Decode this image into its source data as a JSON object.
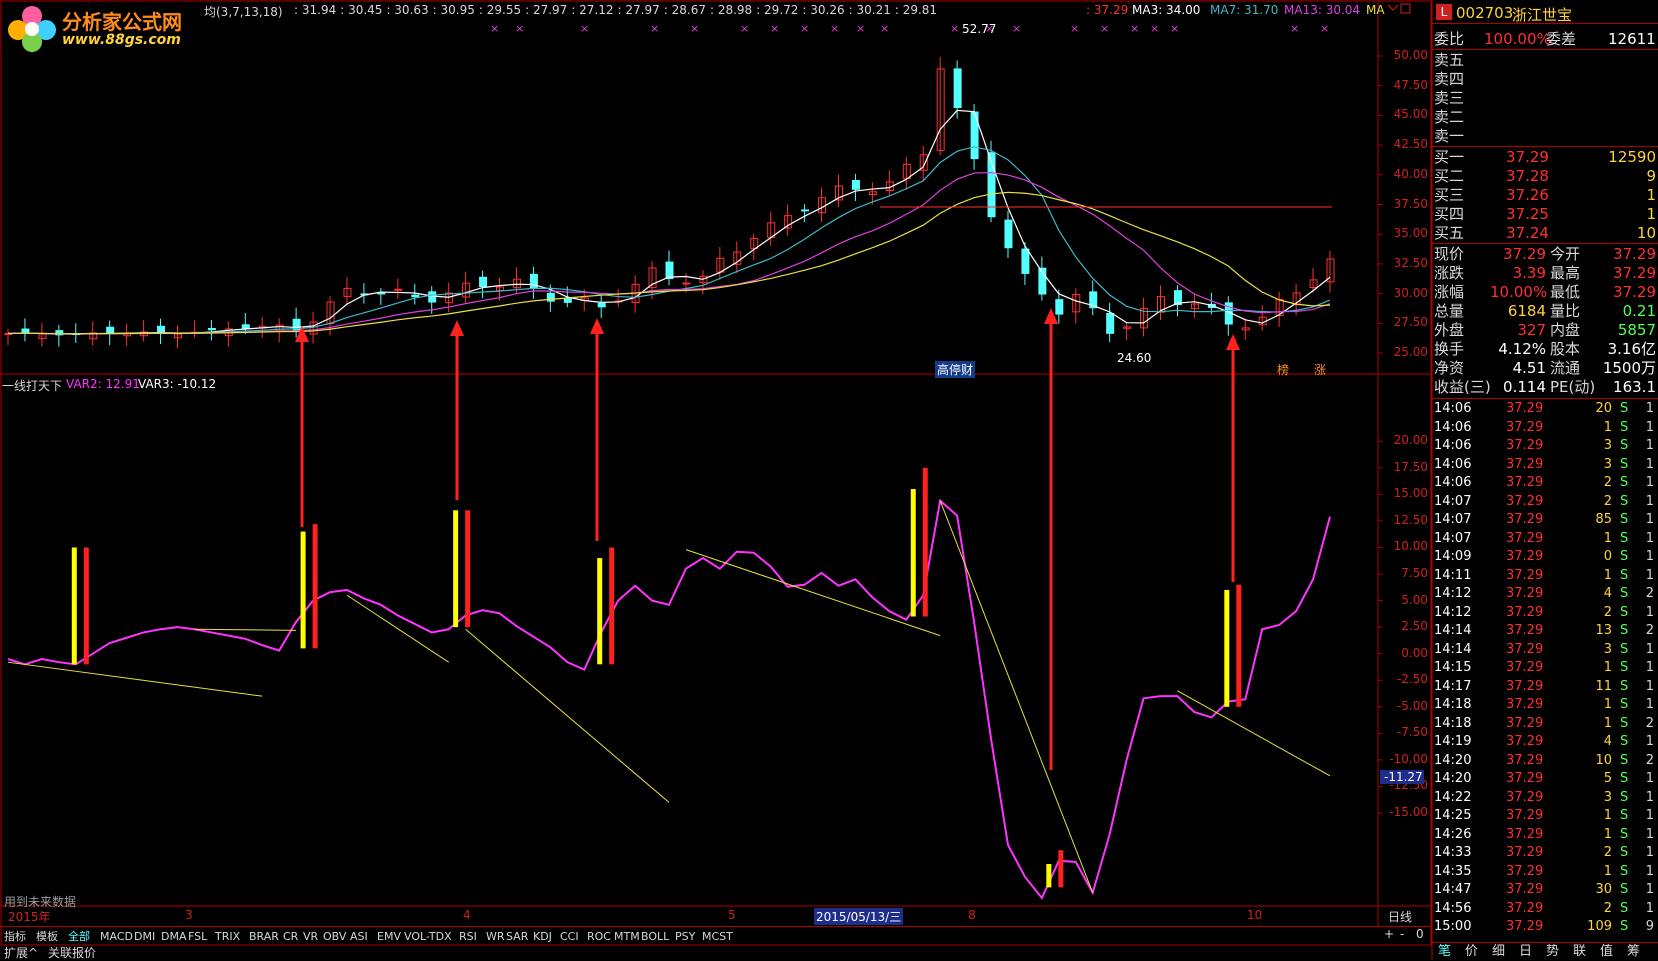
{
  "header": {
    "logo_name": "分析家公式网",
    "logo_url": "www.88gs.com",
    "ma_title": "均(3,7,13,18)",
    "ma_values": [
      ": 31.94",
      ": 30.45",
      ": 30.63",
      ": 30.95",
      ": 29.55",
      ": 27.97",
      ": 27.12",
      ": 27.97",
      ": 28.67",
      ": 28.98",
      ": 29.72",
      ": 30.26",
      ": 30.21",
      ": 29.81"
    ],
    "price_tag": ": 37.29",
    "ma3": "MA3: 34.00",
    "ma7": "MA7: 31.70",
    "ma13": "MA13: 30.04",
    "ma_more": "MA"
  },
  "main_chart": {
    "y_ticks": [
      "50.00",
      "47.50",
      "45.00",
      "42.50",
      "40.00",
      "37.50",
      "35.00",
      "32.50",
      "30.00",
      "27.50",
      "25.00"
    ],
    "high_label": "52.77",
    "low_label": "24.60",
    "tag_gaotingcai": "高停财",
    "tag_bang": "榜",
    "tag_zhang": "涨"
  },
  "sub_chart": {
    "title": "一线打天下",
    "var2": "VAR2: 12.91",
    "var3": "VAR3: -10.12",
    "y_ticks": [
      "20.00",
      "17.50",
      "15.00",
      "12.50",
      "10.00",
      "7.50",
      "5.00",
      "2.50",
      "0.00",
      "-2.50",
      "-5.00",
      "-7.50",
      "-10.00",
      "-12.50",
      "-15.00"
    ],
    "current_marker": "-11.27",
    "note": "用到未来数据",
    "var2_series": [
      -0.5,
      -1.0,
      -0.5,
      -0.8,
      -1.0,
      0.0,
      1.0,
      1.5,
      2.0,
      2.3,
      2.5,
      2.3,
      2.0,
      1.7,
      1.4,
      0.8,
      0.3,
      3.0,
      5.0,
      5.8,
      6.0,
      5.2,
      4.6,
      3.6,
      2.8,
      2.0,
      2.3,
      3.6,
      4.1,
      3.8,
      2.6,
      1.6,
      0.6,
      -0.8,
      -1.5,
      2.0,
      5.0,
      6.4,
      5.0,
      4.6,
      8.0,
      9.0,
      8.0,
      9.6,
      9.5,
      8.2,
      6.3,
      6.5,
      7.6,
      6.4,
      7.0,
      5.3,
      4.0,
      3.2,
      5.5,
      14.4,
      13.0,
      3.0,
      -8.0,
      -18.0,
      -21.0,
      -23.0,
      -19.5,
      -19.6,
      -22.5,
      -17.0,
      -10.0,
      -4.2,
      -4.0,
      -4.0,
      -5.5,
      -6.0,
      -4.5,
      -4.3,
      2.3,
      2.7,
      4.0,
      7.0,
      12.9
    ],
    "yellow_lines": [
      {
        "from": [
          0,
          -0.8
        ],
        "to": [
          15,
          -4.0
        ]
      },
      {
        "from": [
          11,
          2.3
        ],
        "to": [
          17,
          2.2
        ]
      },
      {
        "from": [
          20,
          5.5
        ],
        "to": [
          26,
          -0.8
        ]
      },
      {
        "from": [
          27,
          2.3
        ],
        "to": [
          39,
          -14.0
        ]
      },
      {
        "from": [
          40,
          9.8
        ],
        "to": [
          55,
          1.7
        ]
      },
      {
        "from": [
          55,
          14.4
        ],
        "to": [
          64,
          -22.5
        ]
      },
      {
        "from": [
          69,
          -3.5
        ],
        "to": [
          78,
          -11.5
        ]
      }
    ]
  },
  "signals": [
    {
      "x": 4.0,
      "yellow": 10.0,
      "red": 10.0,
      "base": -1.0
    },
    {
      "x": 17.5,
      "yellow": 11.5,
      "red": 12.2,
      "base": 0.5
    },
    {
      "x": 26.5,
      "yellow": 13.5,
      "red": 13.5,
      "base": 2.5
    },
    {
      "x": 35.0,
      "yellow": 9.0,
      "red": 10.0,
      "base": -1.0
    },
    {
      "x": 53.5,
      "yellow": 15.5,
      "red": 17.5,
      "base": 3.5
    },
    {
      "x": 61.5,
      "yellow": -19.8,
      "red": -18.5,
      "base": -22.0
    },
    {
      "x": 72.0,
      "yellow": 6.0,
      "red": 6.5,
      "base": -5.0
    }
  ],
  "date_axis": {
    "year": "2015年",
    "marks": [
      "3",
      "4",
      "5",
      "2015/05/13/三",
      "8",
      "10"
    ],
    "period": "日线"
  },
  "indicator_tabs": [
    "指标",
    "模板",
    "全部",
    "MACD",
    "DMI",
    "DMA",
    "FSL",
    "TRIX",
    "BRAR",
    "CR",
    "VR",
    "OBV",
    "ASI",
    "EMV",
    "VOL-TDX",
    "RSI",
    "WR",
    "SAR",
    "KDJ",
    "CCI",
    "ROC",
    "MTM",
    "BOLL",
    "PSY",
    "MCST"
  ],
  "bottom_links": [
    "扩展^",
    "关联报价"
  ],
  "zoom_buttons": [
    "+",
    "-",
    "0"
  ],
  "quote": {
    "code": "002703",
    "name": "浙江世宝",
    "weibi_label": "委比",
    "weibi": "100.00%",
    "weicha_label": "委差",
    "weicha": "12611",
    "sells": [
      "卖五",
      "卖四",
      "卖三",
      "卖二",
      "卖一"
    ],
    "buys": [
      {
        "label": "买一",
        "price": "37.29",
        "vol": "12590"
      },
      {
        "label": "买二",
        "price": "37.28",
        "vol": "9"
      },
      {
        "label": "买三",
        "price": "37.26",
        "vol": "1"
      },
      {
        "label": "买四",
        "price": "37.25",
        "vol": "1"
      },
      {
        "label": "买五",
        "price": "37.24",
        "vol": "10"
      }
    ],
    "stats": [
      {
        "l1": "现价",
        "v1": "37.29",
        "l2": "今开",
        "v2": "37.29"
      },
      {
        "l1": "涨跌",
        "v1": "3.39",
        "l2": "最高",
        "v2": "37.29"
      },
      {
        "l1": "涨幅",
        "v1": "10.00%",
        "l2": "最低",
        "v2": "37.29"
      },
      {
        "l1": "总量",
        "v1": "6184",
        "l2": "量比",
        "v2": "0.21"
      },
      {
        "l1": "外盘",
        "v1": "327",
        "l2": "内盘",
        "v2": "5857"
      },
      {
        "l1": "换手",
        "v1": "4.12%",
        "l2": "股本",
        "v2": "3.16亿"
      },
      {
        "l1": "净资",
        "v1": "4.51",
        "l2": "流通",
        "v2": "1500万"
      },
      {
        "l1": "收益(三)",
        "v1": "0.114",
        "l2": "PE(动)",
        "v2": "163.1"
      }
    ],
    "ticks": [
      {
        "t": "14:06",
        "p": "37.29",
        "v": "20",
        "s": "S",
        "n": "1"
      },
      {
        "t": "14:06",
        "p": "37.29",
        "v": "1",
        "s": "S",
        "n": "1"
      },
      {
        "t": "14:06",
        "p": "37.29",
        "v": "3",
        "s": "S",
        "n": "1"
      },
      {
        "t": "14:06",
        "p": "37.29",
        "v": "3",
        "s": "S",
        "n": "1"
      },
      {
        "t": "14:06",
        "p": "37.29",
        "v": "2",
        "s": "S",
        "n": "1"
      },
      {
        "t": "14:07",
        "p": "37.29",
        "v": "2",
        "s": "S",
        "n": "1"
      },
      {
        "t": "14:07",
        "p": "37.29",
        "v": "85",
        "s": "S",
        "n": "1"
      },
      {
        "t": "14:07",
        "p": "37.29",
        "v": "1",
        "s": "S",
        "n": "1"
      },
      {
        "t": "14:09",
        "p": "37.29",
        "v": "0",
        "s": "S",
        "n": "1"
      },
      {
        "t": "14:11",
        "p": "37.29",
        "v": "1",
        "s": "S",
        "n": "1"
      },
      {
        "t": "14:12",
        "p": "37.29",
        "v": "4",
        "s": "S",
        "n": "2"
      },
      {
        "t": "14:12",
        "p": "37.29",
        "v": "2",
        "s": "S",
        "n": "1"
      },
      {
        "t": "14:14",
        "p": "37.29",
        "v": "13",
        "s": "S",
        "n": "2"
      },
      {
        "t": "14:14",
        "p": "37.29",
        "v": "3",
        "s": "S",
        "n": "1"
      },
      {
        "t": "14:15",
        "p": "37.29",
        "v": "1",
        "s": "S",
        "n": "1"
      },
      {
        "t": "14:17",
        "p": "37.29",
        "v": "11",
        "s": "S",
        "n": "1"
      },
      {
        "t": "14:18",
        "p": "37.29",
        "v": "1",
        "s": "S",
        "n": "1"
      },
      {
        "t": "14:18",
        "p": "37.29",
        "v": "1",
        "s": "S",
        "n": "2"
      },
      {
        "t": "14:19",
        "p": "37.29",
        "v": "4",
        "s": "S",
        "n": "1"
      },
      {
        "t": "14:20",
        "p": "37.29",
        "v": "10",
        "s": "S",
        "n": "2"
      },
      {
        "t": "14:20",
        "p": "37.29",
        "v": "5",
        "s": "S",
        "n": "1"
      },
      {
        "t": "14:22",
        "p": "37.29",
        "v": "3",
        "s": "S",
        "n": "1"
      },
      {
        "t": "14:25",
        "p": "37.29",
        "v": "1",
        "s": "S",
        "n": "1"
      },
      {
        "t": "14:26",
        "p": "37.29",
        "v": "1",
        "s": "S",
        "n": "1"
      },
      {
        "t": "14:33",
        "p": "37.29",
        "v": "2",
        "s": "S",
        "n": "1"
      },
      {
        "t": "14:35",
        "p": "37.29",
        "v": "1",
        "s": "S",
        "n": "1"
      },
      {
        "t": "14:47",
        "p": "37.29",
        "v": "30",
        "s": "S",
        "n": "1"
      },
      {
        "t": "14:56",
        "p": "37.29",
        "v": "2",
        "s": "S",
        "n": "1"
      },
      {
        "t": "15:00",
        "p": "37.29",
        "v": "109",
        "s": "S",
        "n": "9"
      }
    ],
    "bottom_tabs": [
      "笔",
      "价",
      "细",
      "日",
      "势",
      "联",
      "值",
      "筹"
    ]
  },
  "colors": {
    "up": "#ff3030",
    "down": "#54ffff",
    "grid": "#b00000",
    "ma_white": "#ffffff",
    "ma_cyan": "#3fb8c8",
    "ma_magenta": "#e040e0",
    "ma_yellow": "#e8e040",
    "var2_line": "#ff33ff",
    "signal_yellow": "#ffff00",
    "signal_red": "#ff2020"
  }
}
